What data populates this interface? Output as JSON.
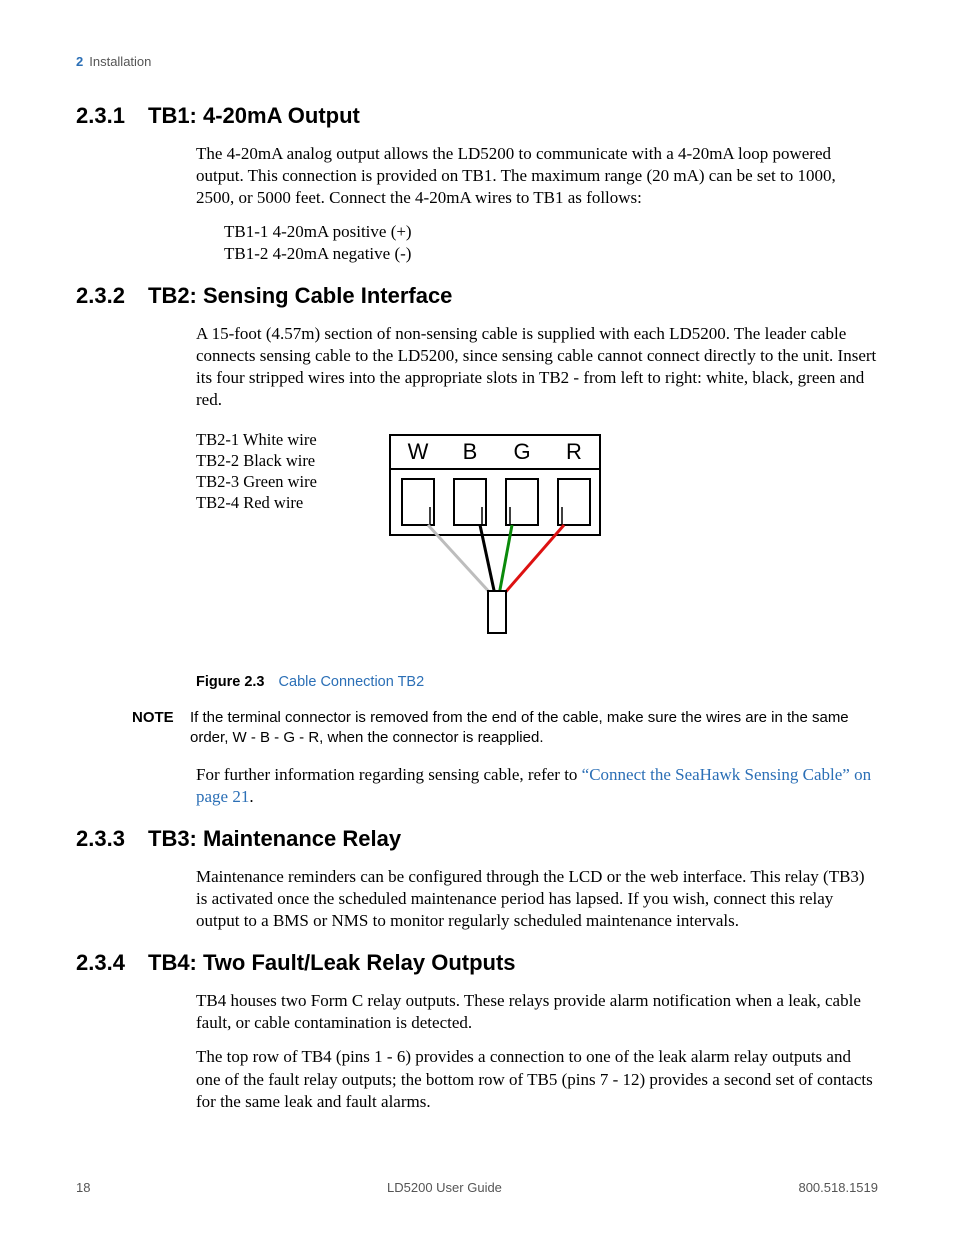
{
  "header": {
    "chapter_num": "2",
    "chapter_title": "Installation"
  },
  "sections": {
    "s231": {
      "num": "2.3.1",
      "title": "TB1: 4-20mA Output",
      "p1": "The 4-20mA analog output allows the LD5200 to communicate with a 4-20mA loop powered output. This connection is provided on TB1. The maximum range (20 mA) can be set to 1000, 2500, or 5000 feet. Connect the 4-20mA wires to TB1 as follows:",
      "l1": "TB1-1 4-20mA positive (+)",
      "l2": "TB1-2 4-20mA negative (-)"
    },
    "s232": {
      "num": "2.3.2",
      "title": "TB2: Sensing Cable Interface",
      "p1": "A 15-foot (4.57m) section of non-sensing cable is supplied with each LD5200. The leader cable connects sensing cable to the LD5200, since sensing cable cannot connect directly to the unit. Insert its four stripped wires into the appropriate slots in TB2 - from left to right: white, black, green and red.",
      "w1": "TB2-1 White wire",
      "w2": "TB2-2 Black wire",
      "w3": "TB2-3 Green wire",
      "w4": "TB2-4 Red wire",
      "fig_num": "Figure 2.3",
      "fig_title": "Cable Connection TB2",
      "note_label": "NOTE",
      "note_body": "If the terminal connector is removed from the end of the cable, make sure the wires are in the same order, W - B - G - R, when the connector is reapplied.",
      "p2_a": "For further information regarding sensing cable, refer to ",
      "p2_link": "“Connect the SeaHawk Sensing Cable” on page 21",
      "p2_b": "."
    },
    "s233": {
      "num": "2.3.3",
      "title": "TB3: Maintenance Relay",
      "p1": "Maintenance reminders can be configured through the LCD or the web interface. This relay (TB3) is activated once the scheduled maintenance period has lapsed. If you wish, connect this relay output to a BMS or NMS to monitor regularly scheduled maintenance intervals."
    },
    "s234": {
      "num": "2.3.4",
      "title": "TB4: Two Fault/Leak Relay Outputs",
      "p1": "TB4 houses two Form C relay outputs. These relays provide alarm notification when a leak, cable fault, or cable contamination is detected.",
      "p2": "The top row of TB4 (pins 1 - 6) provides a connection to one of the leak alarm relay outputs and one of the fault relay outputs; the bottom row of TB5 (pins 7 - 12) provides a second set of contacts for the same leak and fault alarms."
    }
  },
  "diagram": {
    "labels": {
      "W": "W",
      "B": "B",
      "G": "G",
      "R": "R"
    }
  },
  "footer": {
    "page": "18",
    "center": "LD5200 User Guide",
    "right": "800.518.1519"
  }
}
